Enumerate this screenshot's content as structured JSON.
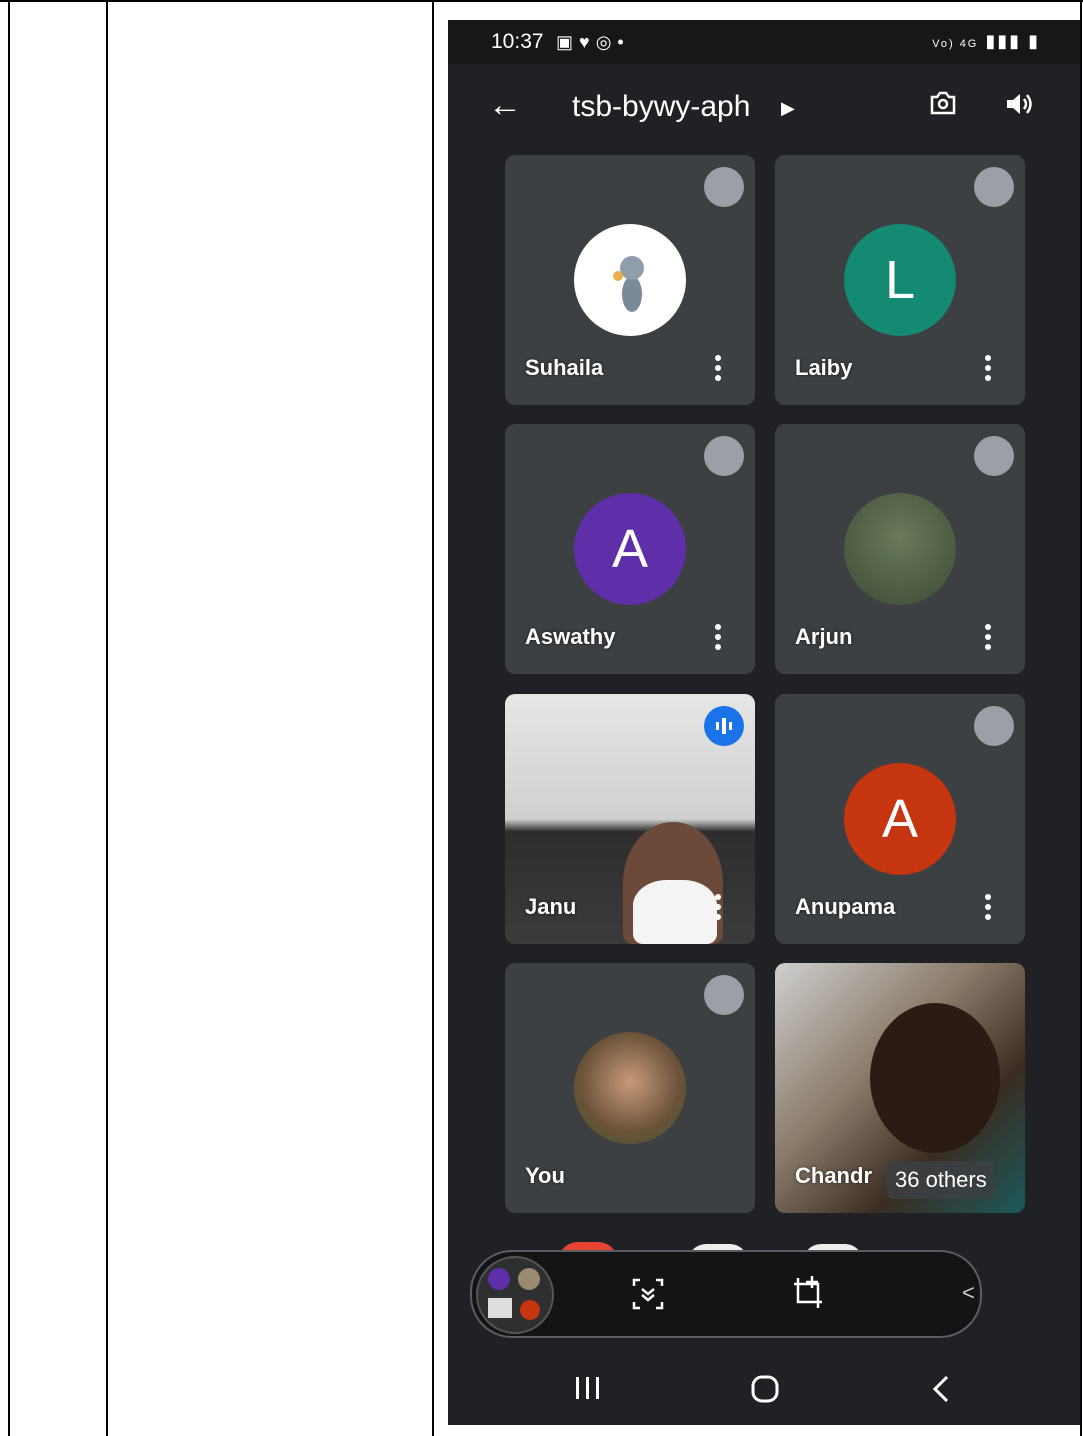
{
  "status_bar": {
    "time": "10:37",
    "indicators": "Vo) 4G"
  },
  "meeting": {
    "code": "tsb-bywy-aph"
  },
  "tiles": [
    {
      "name": "Suhaila",
      "avatar": "tom-cat-image",
      "state": "muted"
    },
    {
      "name": "Laiby",
      "initial": "L",
      "color": "#158a73",
      "state": "muted"
    },
    {
      "name": "Aswathy",
      "initial": "A",
      "color": "#5f2ea9",
      "state": "muted"
    },
    {
      "name": "Arjun",
      "avatar": "photo",
      "state": "muted"
    },
    {
      "name": "Janu",
      "avatar": "video",
      "state": "speaking"
    },
    {
      "name": "Anupama",
      "initial": "A",
      "color": "#c5350f",
      "state": "muted"
    },
    {
      "name": "You",
      "avatar": "photo",
      "state": "muted"
    },
    {
      "name": "Chandr",
      "others": "36 others",
      "avatar": "video"
    }
  ],
  "icons": {
    "back": "arrow-left-icon",
    "camera": "switch-camera-icon",
    "audio": "speaker-icon",
    "mute": "mic-off-icon",
    "speaking": "audio-wave-icon",
    "more": "more-vert-icon"
  }
}
